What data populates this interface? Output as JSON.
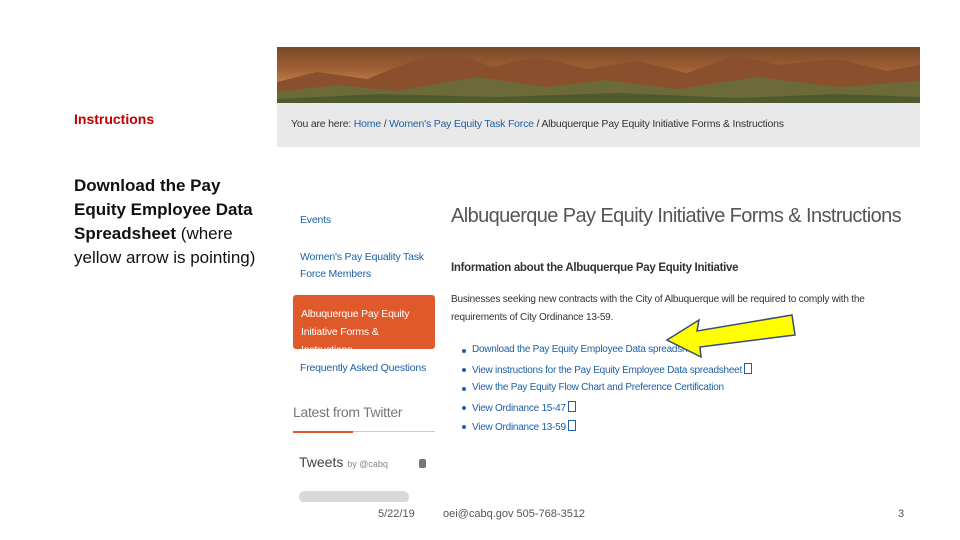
{
  "slide": {
    "title": "Instructions",
    "body_bold": "Download the Pay Equity Employee Data Spreadsheet",
    "body_normal": "(where yellow arrow is pointing)"
  },
  "site": {
    "breadcrumb_prefix": "You are here:",
    "breadcrumb_home": "Home",
    "breadcrumb_task_force": "Women's Pay Equity Task Force",
    "breadcrumb_current": "Albuquerque Pay Equity Initiative Forms & Instructions",
    "sidebar": {
      "events": "Events",
      "task_force_members": "Women's Pay Equality Task Force Members",
      "forms_active": "Albuquerque Pay Equity Initiative Forms & Instructions",
      "faq": "Frequently Asked Questions",
      "twitter_heading": "Latest from Twitter",
      "tweets_label": "Tweets",
      "tweets_by": "by @cabq"
    },
    "main": {
      "title": "Albuquerque Pay Equity Initiative Forms & Instructions",
      "info_heading": "Information about the Albuquerque Pay Equity Initiative",
      "info_paragraph": "Businesses seeking new contracts with the City of Albuquerque will be required to comply with the requirements of City Ordinance 13-59.",
      "links": [
        "Download the Pay Equity Employee Data spreadsheet",
        "View instructions for the Pay Equity Employee Data spreadsheet",
        "View the Pay Equity Flow Chart and Preference Certification",
        "View Ordinance 15-47",
        "View Ordinance 13-59"
      ]
    }
  },
  "footer": {
    "date": "5/22/19",
    "contact": "oei@cabq.gov 505-768-3512",
    "page": "3"
  },
  "colors": {
    "title_red": "#c00000",
    "link_blue": "#1f5fa8",
    "active_orange": "#e0592a",
    "arrow_yellow": "#ffff00"
  },
  "icons": [
    "pdf-icon",
    "info-icon",
    "yellow-arrow-icon"
  ]
}
